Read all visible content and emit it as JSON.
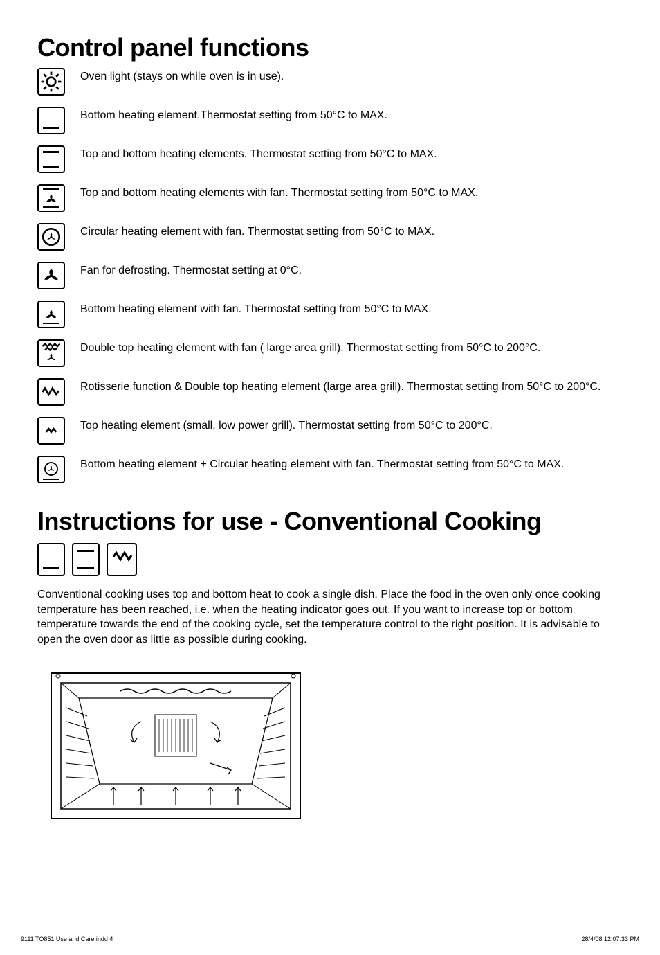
{
  "heading1": "Control panel functions",
  "functions": [
    {
      "icon": "light",
      "desc": "Oven light (stays on while oven is in use)."
    },
    {
      "icon": "bottom",
      "desc": "Bottom heating element.Thermostat setting from 50°C to MAX."
    },
    {
      "icon": "top-bottom",
      "desc": "Top and bottom heating elements. Thermostat setting from 50°C to MAX."
    },
    {
      "icon": "top-bottom-fan",
      "desc": "Top and bottom heating elements with fan. Thermostat setting from 50°C to MAX."
    },
    {
      "icon": "circ-fan",
      "desc": "Circular heating element with fan. Thermostat setting from 50°C to MAX."
    },
    {
      "icon": "fan-defrost",
      "desc": "Fan for defrosting. Thermostat setting at 0°C."
    },
    {
      "icon": "bottom-fan",
      "desc": "Bottom heating element with fan. Thermostat setting from 50°C to MAX."
    },
    {
      "icon": "dbl-top-fan",
      "desc": "Double top heating element with fan ( large area grill). Thermostat setting from 50°C to 200°C."
    },
    {
      "icon": "rotisserie",
      "desc": "Rotisserie function & Double top heating element (large area grill). Thermostat setting from 50°C to 200°C."
    },
    {
      "icon": "top-small",
      "desc": "Top heating element (small, low power grill). Thermostat setting from 50°C to 200°C."
    },
    {
      "icon": "bottom-circ-fan",
      "desc": "Bottom heating element + Circular heating element with fan. Thermostat setting from 50°C to MAX."
    }
  ],
  "heading2": "Instructions for use - Conventional Cooking",
  "conv_icons": [
    "bottom",
    "top-bottom",
    "rotisserie"
  ],
  "conv_body": "Conventional cooking uses top and bottom heat to cook a single dish. Place the food in the oven only once cooking temperature has  been reached, i.e. when the heating indicator goes out. If you want to increase top or bottom temperature towards the end of the cooking cycle, set the temperature control to the right position. It is advisable to open the oven door as little as possible during cooking.",
  "footer_left": "9111 TO851 Use and Care.indd   4",
  "footer_right": "28/4/08   12:07:33 PM"
}
